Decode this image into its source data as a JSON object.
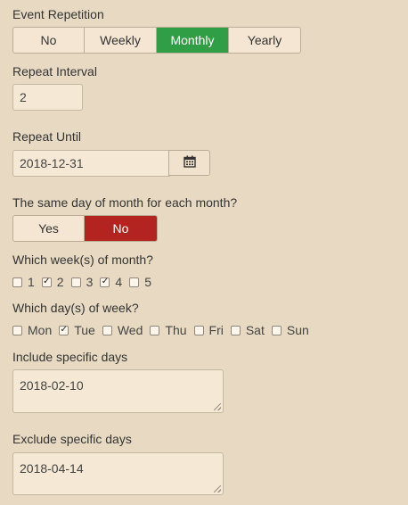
{
  "event_repetition": {
    "label": "Event Repetition",
    "options": [
      "No",
      "Weekly",
      "Monthly",
      "Yearly"
    ],
    "selected": "Monthly"
  },
  "repeat_interval": {
    "label": "Repeat Interval",
    "value": "2"
  },
  "repeat_until": {
    "label": "Repeat Until",
    "value": "2018-12-31",
    "calendar_icon": "calendar-icon"
  },
  "same_day": {
    "label": "The same day of month for each month?",
    "options": [
      "Yes",
      "No"
    ],
    "selected": "No"
  },
  "weeks": {
    "label": "Which week(s) of month?",
    "items": [
      {
        "label": "1",
        "checked": false
      },
      {
        "label": "2",
        "checked": true
      },
      {
        "label": "3",
        "checked": false
      },
      {
        "label": "4",
        "checked": true
      },
      {
        "label": "5",
        "checked": false
      }
    ]
  },
  "days": {
    "label": "Which day(s) of week?",
    "items": [
      {
        "label": "Mon",
        "checked": false
      },
      {
        "label": "Tue",
        "checked": true
      },
      {
        "label": "Wed",
        "checked": false
      },
      {
        "label": "Thu",
        "checked": false
      },
      {
        "label": "Fri",
        "checked": false
      },
      {
        "label": "Sat",
        "checked": false
      },
      {
        "label": "Sun",
        "checked": false
      }
    ]
  },
  "include": {
    "label": "Include specific days",
    "value": "2018-02-10"
  },
  "exclude": {
    "label": "Exclude specific days",
    "value": "2018-04-14"
  },
  "colors": {
    "selected_green": "#2f9e44",
    "selected_red": "#b3231f",
    "background": "#e8dac2"
  }
}
